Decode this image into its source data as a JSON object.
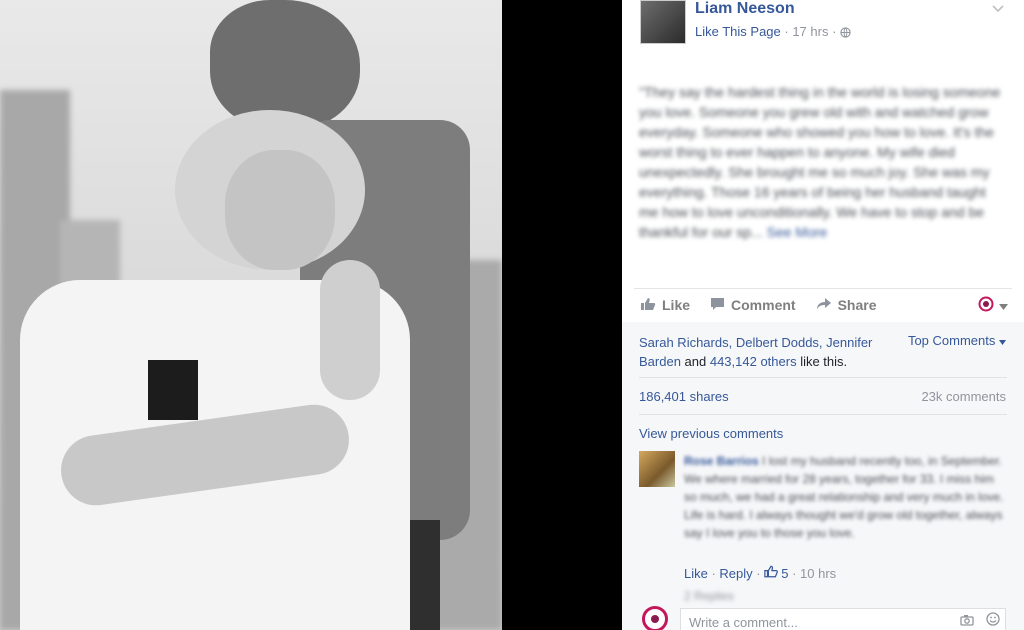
{
  "post": {
    "page_name": "Liam Neeson",
    "like_page": "Like This Page",
    "time": "17 hrs",
    "meta_sep": " · ",
    "globe_icon": "globe-icon",
    "text": "\"They say the hardest thing in the world is losing someone you love. Someone you grew old with and watched grow everyday. Someone who showed you how to love. It's the worst thing to ever happen to anyone. My wife died unexpectedly. She brought me so much joy. She was my everything. Those 16 years of being her husband taught me how to love unconditionally. We have to stop and be thankful for our sp...",
    "see_more": "See More"
  },
  "actions": {
    "like": "Like",
    "comment": "Comment",
    "share": "Share",
    "reaction_icon": "messenger-dot-icon"
  },
  "social": {
    "likers_names": "Sarah Richards, Delbert Dodds, Jennifer Barden",
    "and": " and ",
    "others": "443,142 others",
    "like_this": " like this.",
    "top_comments": "Top Comments",
    "shares": "186,401 shares",
    "comments_count": "23k comments",
    "view_previous": "View previous comments"
  },
  "comment": {
    "author": "Rose Barrios",
    "text": "I lost my husband recently too, in September. We where married for 28 years, together for 33. I miss him so much, we had a great relationship and very much in love. Life is hard. I always thought we'd grow old together, always say I love you to those you love.",
    "like": "Like",
    "reply": "Reply",
    "like_count": "5",
    "time": "10 hrs",
    "replies": "2 Replies"
  },
  "write_comment": {
    "placeholder": "Write a comment...",
    "camera_icon": "camera-icon",
    "emoji_icon": "emoji-icon"
  },
  "colors": {
    "link": "#365899",
    "meta": "#90949c",
    "accent": "#c2185b"
  }
}
